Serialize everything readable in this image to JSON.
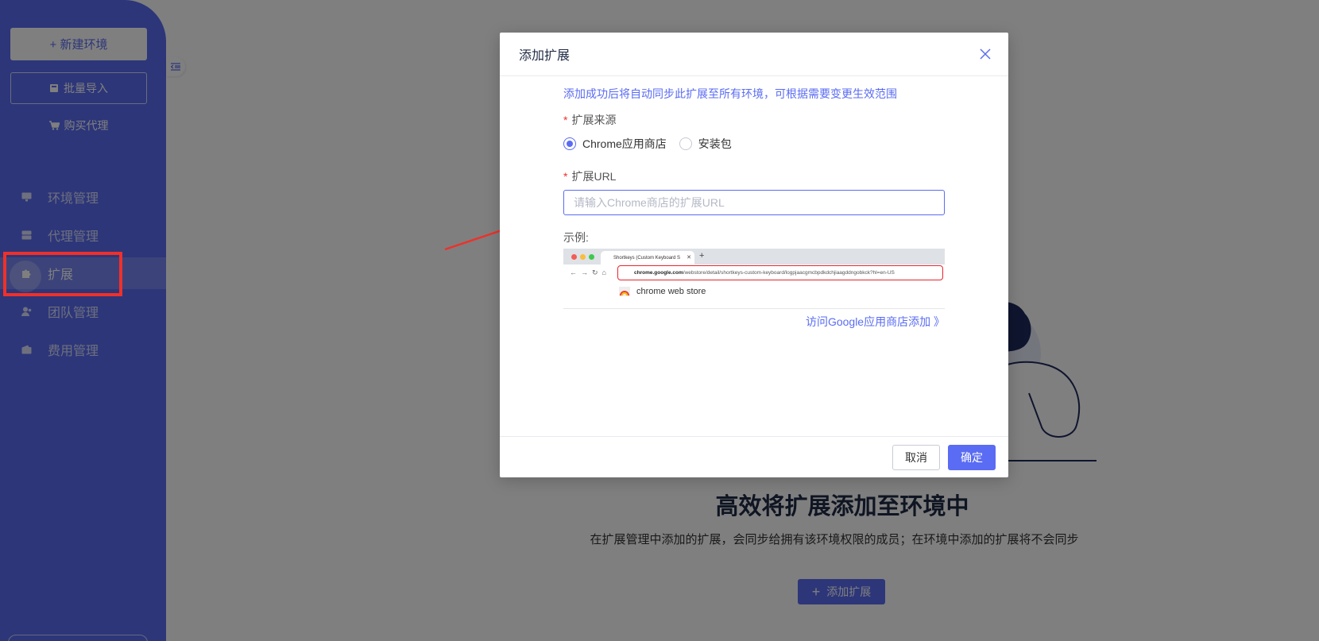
{
  "colors": {
    "accent": "#5a6cf3",
    "annotation_red": "#f0302a"
  },
  "sidebar": {
    "new_env_label": "+ 新建环境",
    "import_label": "批量导入",
    "buy_proxy_label": "购买代理",
    "items": [
      {
        "label": "环境管理",
        "icon": "monitor-icon"
      },
      {
        "label": "代理管理",
        "icon": "server-icon"
      },
      {
        "label": "扩展",
        "icon": "puzzle-icon",
        "active": true
      },
      {
        "label": "团队管理",
        "icon": "team-icon"
      },
      {
        "label": "费用管理",
        "icon": "wallet-icon"
      }
    ]
  },
  "main": {
    "title": "高效将扩展添加至环境中",
    "description": "在扩展管理中添加的扩展，会同步给拥有该环境权限的成员；在环境中添加的扩展将不会同步",
    "add_button": "添加扩展"
  },
  "dialog": {
    "title": "添加扩展",
    "tip": "添加成功后将自动同步此扩展至所有环境，可根据需要变更生效范围",
    "source_label": "扩展来源",
    "source_options": [
      {
        "label": "Chrome应用商店",
        "selected": true
      },
      {
        "label": "安装包",
        "selected": false
      }
    ],
    "url_label": "扩展URL",
    "url_placeholder": "请输入Chrome商店的扩展URL",
    "url_value": "",
    "example_label": "示例:",
    "example": {
      "tab_title": "Shortkeys (Custom Keyboard S",
      "url_domain": "chrome.google.com",
      "url_path": "/webstore/detail/shortkeys-custom-keyboard/logpjaacgmcbpdkdchjiaagddngobkck?hl=en-US",
      "store_name": "chrome web store"
    },
    "visit_link": "访问Google应用商店添加 》",
    "cancel_label": "取消",
    "ok_label": "确定"
  }
}
